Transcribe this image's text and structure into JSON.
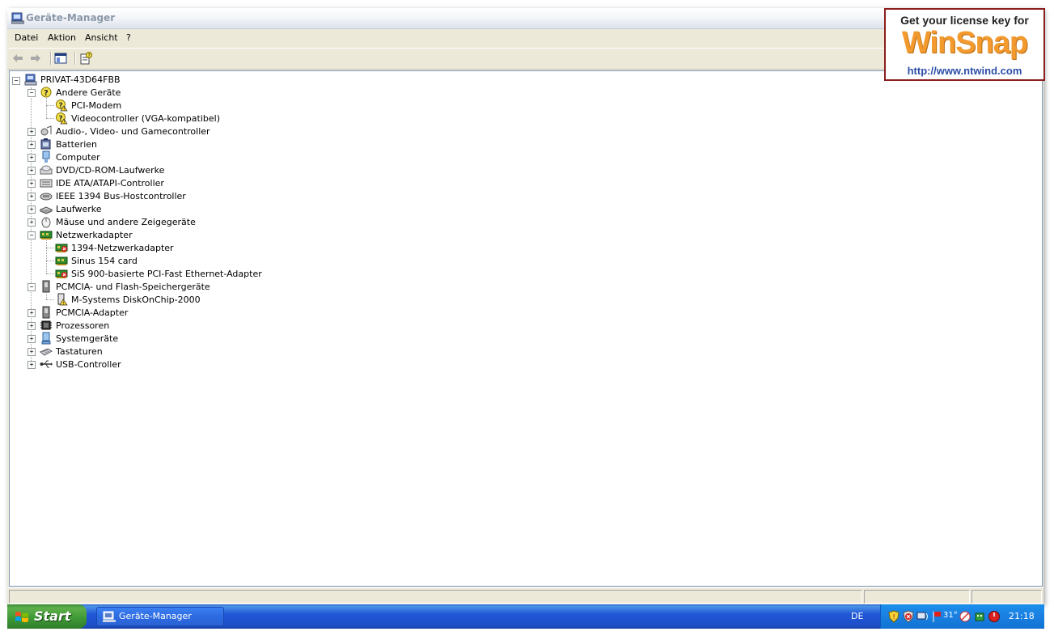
{
  "window": {
    "title": "Geräte-Manager"
  },
  "menu": [
    {
      "label": "Datei"
    },
    {
      "label": "Aktion"
    },
    {
      "label": "Ansicht"
    },
    {
      "label": "?"
    }
  ],
  "toolbar": {
    "buttons": [
      {
        "icon": "back-arrow-icon"
      },
      {
        "icon": "forward-arrow-icon"
      },
      {
        "icon": "show-hide-console-tree-icon"
      },
      {
        "icon": "properties-help-icon"
      }
    ]
  },
  "tree": {
    "root": "PRIVAT-43D64FBB",
    "items": [
      {
        "label": "Andere Geräte",
        "icon": "unknown-device-icon",
        "expanded": true
      },
      {
        "label": "PCI-Modem",
        "icon": "unknown-device-warning-icon"
      },
      {
        "label": "Videocontroller (VGA-kompatibel)",
        "icon": "unknown-device-warning-icon"
      },
      {
        "label": "Audio-, Video- und Gamecontroller",
        "icon": "audio-icon",
        "expanded": false
      },
      {
        "label": "Batterien",
        "icon": "battery-icon",
        "expanded": false
      },
      {
        "label": "Computer",
        "icon": "computer-icon",
        "expanded": false
      },
      {
        "label": "DVD/CD-ROM-Laufwerke",
        "icon": "cdrom-icon",
        "expanded": false
      },
      {
        "label": "IDE ATA/ATAPI-Controller",
        "icon": "ide-controller-icon",
        "expanded": false
      },
      {
        "label": "IEEE 1394 Bus-Hostcontroller",
        "icon": "ieee1394-icon",
        "expanded": false
      },
      {
        "label": "Laufwerke",
        "icon": "disk-drive-icon",
        "expanded": false
      },
      {
        "label": "Mäuse und andere Zeigegeräte",
        "icon": "mouse-icon",
        "expanded": false
      },
      {
        "label": "Netzwerkadapter",
        "icon": "network-adapter-icon",
        "expanded": true
      },
      {
        "label": "1394-Netzwerkadapter",
        "icon": "network-adapter-disabled-icon"
      },
      {
        "label": "Sinus 154 card",
        "icon": "network-adapter-icon"
      },
      {
        "label": "SiS 900-basierte PCI-Fast Ethernet-Adapter",
        "icon": "network-adapter-disabled-icon"
      },
      {
        "label": "PCMCIA- und Flash-Speichergeräte",
        "icon": "pcmcia-icon",
        "expanded": true
      },
      {
        "label": "M-Systems DiskOnChip-2000",
        "icon": "flash-warning-icon"
      },
      {
        "label": "PCMCIA-Adapter",
        "icon": "pcmcia-icon",
        "expanded": false
      },
      {
        "label": "Prozessoren",
        "icon": "processor-icon",
        "expanded": false
      },
      {
        "label": "Systemgeräte",
        "icon": "system-device-icon",
        "expanded": false
      },
      {
        "label": "Tastaturen",
        "icon": "keyboard-icon",
        "expanded": false
      },
      {
        "label": "USB-Controller",
        "icon": "usb-icon",
        "expanded": false
      }
    ]
  },
  "taskbar": {
    "start_label": "Start",
    "task_label": "Geräte-Manager",
    "language": "DE",
    "tray_temp": "31°",
    "clock": "21:18"
  },
  "winsnap": {
    "line1": "Get your license key for",
    "logo": "WinSnap",
    "url": "http://www.ntwind.com"
  },
  "colors": {
    "taskbar_blue": "#2157d7",
    "start_green": "#3f9a36",
    "tray_blue": "#1b82e3",
    "winsnap_orange": "#f39a2e",
    "winsnap_border": "#8b1e1e"
  }
}
